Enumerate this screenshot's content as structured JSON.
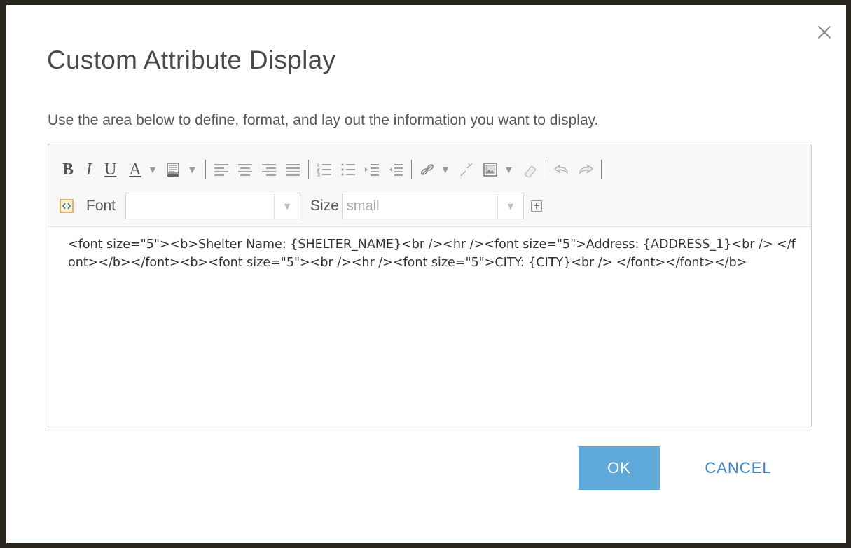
{
  "dialog": {
    "title": "Custom Attribute Display",
    "description": "Use the area below to define, format, and lay out the information you want to display.",
    "close_icon": "close-icon"
  },
  "toolbar": {
    "bold_label": "B",
    "italic_label": "I",
    "underline_label": "U",
    "font_color_label": "A",
    "font_label": "Font",
    "font_value": "",
    "size_label": "Size",
    "size_value": "small"
  },
  "editor": {
    "content": "<font size=\"5\"><b>Shelter Name: {SHELTER_NAME}<br /><hr /><font size=\"5\">Address: {ADDRESS_1}<br /> </font></b></font><b><font size=\"5\"><br /><hr /><font size=\"5\">CITY: {CITY}<br /> </font></font></b>"
  },
  "buttons": {
    "ok": "OK",
    "cancel": "CANCEL"
  },
  "colors": {
    "accent": "#5ea8da",
    "link": "#3f86c6"
  }
}
